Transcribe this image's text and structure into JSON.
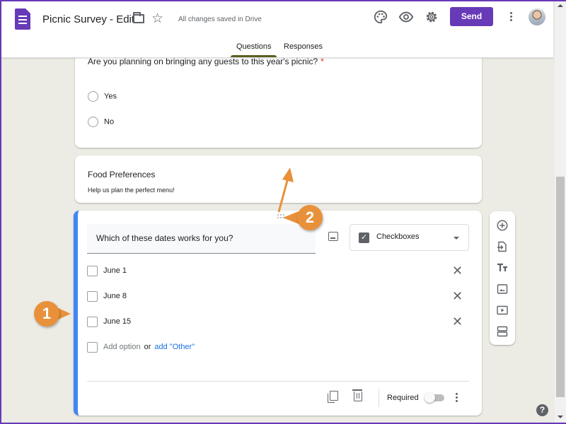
{
  "header": {
    "doc_title": "Picnic Survey - Edit",
    "save_status": "All changes saved in Drive",
    "send_label": "Send",
    "icons": [
      "folder-icon",
      "star-icon",
      "palette-icon",
      "eye-icon",
      "gear-icon",
      "more-vert-icon",
      "avatar"
    ]
  },
  "tabs": [
    {
      "label": "Questions",
      "active": true
    },
    {
      "label": "Responses",
      "active": false
    }
  ],
  "question1": {
    "title": "Are you planning on bringing any guests to this year's picnic?",
    "required_mark": "*",
    "options": [
      "Yes",
      "No"
    ]
  },
  "section": {
    "title": "Food Preferences",
    "description": "Help us plan the perfect menu!"
  },
  "question2": {
    "title": "Which of these dates works for you?",
    "type": "Checkboxes",
    "options": [
      "June 1",
      "June 8",
      "June 15"
    ],
    "add_option": "Add option",
    "or_text": "or",
    "add_other": "add \"Other\"",
    "required_label": "Required",
    "required_on": false
  },
  "toolbar": {
    "items": [
      "add-question",
      "import-questions",
      "add-title-and-description",
      "add-image",
      "add-video",
      "add-section"
    ]
  },
  "callouts": [
    "1",
    "2"
  ],
  "help": "?",
  "scroll": {
    "position_fraction": 0.55,
    "visible_fraction": 0.52
  },
  "colors": {
    "brand": "#673ab7",
    "accent_blue": "#4285f4",
    "link": "#1a73e8",
    "callout": "#e8913a",
    "background": "#ecebe4"
  }
}
